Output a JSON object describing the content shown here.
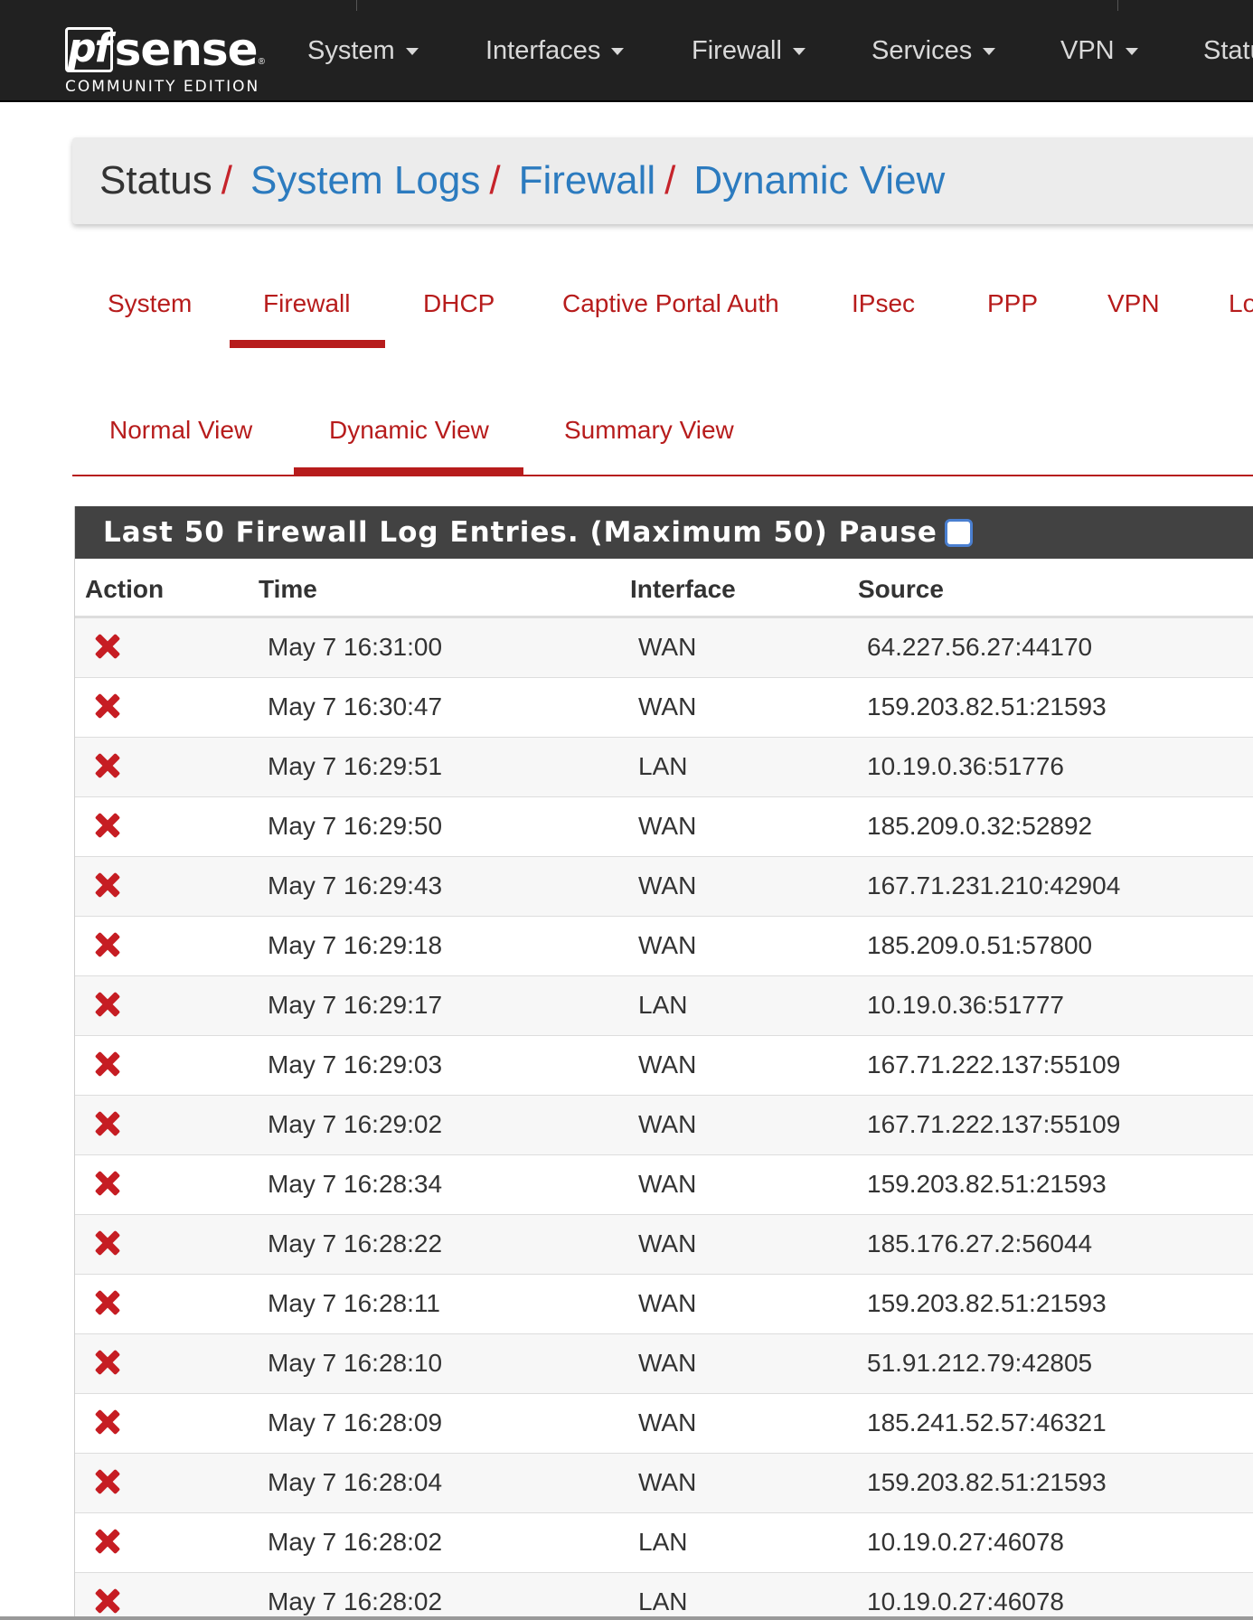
{
  "navbar": {
    "brand": {
      "logo_pf": "pf",
      "logo_sense": "sense",
      "edition": "COMMUNITY EDITION"
    },
    "menu": [
      {
        "label": "System"
      },
      {
        "label": "Interfaces"
      },
      {
        "label": "Firewall"
      },
      {
        "label": "Services"
      },
      {
        "label": "VPN"
      },
      {
        "label": "Statu"
      }
    ]
  },
  "breadcrumb": {
    "root": "Status",
    "links": [
      "System Logs",
      "Firewall",
      "Dynamic View"
    ]
  },
  "log_tabs": {
    "items": [
      "System",
      "Firewall",
      "DHCP",
      "Captive Portal Auth",
      "IPsec",
      "PPP",
      "VPN",
      "Lo"
    ],
    "active": "Firewall"
  },
  "view_tabs": {
    "items": [
      "Normal View",
      "Dynamic View",
      "Summary View"
    ],
    "active": "Dynamic View"
  },
  "panel": {
    "title": "Last 50 Firewall Log Entries. (Maximum 50) Pause",
    "pause_checked": false,
    "columns": [
      "Action",
      "Time",
      "Interface",
      "Source"
    ],
    "rows": [
      {
        "action": "block",
        "time": "May 7 16:31:00",
        "interface": "WAN",
        "source": "64.227.56.27:44170"
      },
      {
        "action": "block",
        "time": "May 7 16:30:47",
        "interface": "WAN",
        "source": "159.203.82.51:21593"
      },
      {
        "action": "block",
        "time": "May 7 16:29:51",
        "interface": "LAN",
        "source": "10.19.0.36:51776"
      },
      {
        "action": "block",
        "time": "May 7 16:29:50",
        "interface": "WAN",
        "source": "185.209.0.32:52892"
      },
      {
        "action": "block",
        "time": "May 7 16:29:43",
        "interface": "WAN",
        "source": "167.71.231.210:42904"
      },
      {
        "action": "block",
        "time": "May 7 16:29:18",
        "interface": "WAN",
        "source": "185.209.0.51:57800"
      },
      {
        "action": "block",
        "time": "May 7 16:29:17",
        "interface": "LAN",
        "source": "10.19.0.36:51777"
      },
      {
        "action": "block",
        "time": "May 7 16:29:03",
        "interface": "WAN",
        "source": "167.71.222.137:55109"
      },
      {
        "action": "block",
        "time": "May 7 16:29:02",
        "interface": "WAN",
        "source": "167.71.222.137:55109"
      },
      {
        "action": "block",
        "time": "May 7 16:28:34",
        "interface": "WAN",
        "source": "159.203.82.51:21593"
      },
      {
        "action": "block",
        "time": "May 7 16:28:22",
        "interface": "WAN",
        "source": "185.176.27.2:56044"
      },
      {
        "action": "block",
        "time": "May 7 16:28:11",
        "interface": "WAN",
        "source": "159.203.82.51:21593"
      },
      {
        "action": "block",
        "time": "May 7 16:28:10",
        "interface": "WAN",
        "source": "51.91.212.79:42805"
      },
      {
        "action": "block",
        "time": "May 7 16:28:09",
        "interface": "WAN",
        "source": "185.241.52.57:46321"
      },
      {
        "action": "block",
        "time": "May 7 16:28:04",
        "interface": "WAN",
        "source": "159.203.82.51:21593"
      },
      {
        "action": "block",
        "time": "May 7 16:28:02",
        "interface": "LAN",
        "source": "10.19.0.27:46078"
      },
      {
        "action": "block",
        "time": "May 7 16:28:02",
        "interface": "LAN",
        "source": "10.19.0.27:46078"
      }
    ]
  },
  "colors": {
    "navbar_bg": "#212121",
    "accent_red": "#b71c1c",
    "link_blue": "#2c7bbf",
    "block_icon": "#c61d23",
    "panel_heading_bg": "#424242"
  },
  "icons": {
    "action_block": "close-x-icon",
    "menu_caret": "caret-down-icon"
  }
}
